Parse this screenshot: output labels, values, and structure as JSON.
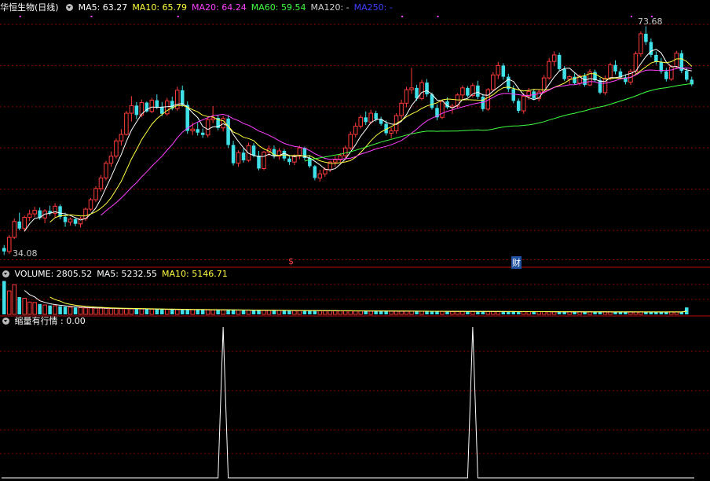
{
  "stock": {
    "name": "华恒生物",
    "period": "(日线)"
  },
  "ma_legend": [
    {
      "label": "MA5: 63.27",
      "color": "#ffffff"
    },
    {
      "label": "MA10: 65.79",
      "color": "#ffff40"
    },
    {
      "label": "MA20: 64.24",
      "color": "#ff40ff"
    },
    {
      "label": "MA60: 59.54",
      "color": "#40ff40"
    },
    {
      "label": "MA120: -",
      "color": "#d0d0d0"
    },
    {
      "label": "MA250: -",
      "color": "#4040ff"
    }
  ],
  "volume_legend": [
    {
      "label": "VOLUME: 2805.52",
      "color": "#ffffff"
    },
    {
      "label": "MA5: 5232.55",
      "color": "#ffffff"
    },
    {
      "label": "MA10: 5146.71",
      "color": "#ffff40"
    }
  ],
  "indicator_legend": {
    "label": "缩量有行情 : 0.00",
    "color": "#ffffff"
  },
  "price_high_label": "73.68",
  "price_low_label": "34.08",
  "event_badges": [
    {
      "text": "$",
      "color": "#ff4040",
      "bg": "#000000"
    },
    {
      "text": "财",
      "color": "#ffffff",
      "bg": "#2050a0"
    }
  ],
  "colors": {
    "up": "#ff3b3b",
    "down": "#40e0e8",
    "grid": "#8b0000",
    "ma5": "#ffffff",
    "ma10": "#ffff40",
    "ma20": "#ff40ff",
    "ma60": "#40ff40"
  },
  "chart_data": {
    "type": "candlestick",
    "price_range": [
      33,
      76
    ],
    "candles": [
      [
        36.0,
        36.5,
        34.8,
        35.4
      ],
      [
        35.4,
        38.2,
        35.0,
        37.8
      ],
      [
        37.8,
        41.0,
        37.5,
        40.5
      ],
      [
        40.5,
        42.0,
        39.0,
        39.3
      ],
      [
        39.3,
        41.5,
        38.8,
        41.2
      ],
      [
        41.2,
        42.5,
        40.6,
        41.8
      ],
      [
        41.8,
        43.0,
        41.3,
        42.4
      ],
      [
        42.4,
        42.9,
        40.8,
        41.1
      ],
      [
        41.1,
        42.6,
        40.2,
        42.3
      ],
      [
        42.3,
        43.2,
        41.5,
        41.9
      ],
      [
        41.9,
        43.6,
        41.2,
        43.1
      ],
      [
        43.1,
        43.4,
        40.9,
        41.3
      ],
      [
        41.3,
        42.0,
        39.6,
        40.4
      ],
      [
        40.4,
        41.2,
        39.8,
        40.9
      ],
      [
        40.9,
        41.1,
        39.7,
        40.1
      ],
      [
        40.1,
        41.3,
        39.5,
        41.0
      ],
      [
        41.0,
        42.9,
        40.6,
        42.6
      ],
      [
        42.6,
        44.5,
        42.3,
        44.2
      ],
      [
        44.2,
        46.5,
        43.8,
        46.1
      ],
      [
        46.1,
        48.4,
        45.6,
        47.9
      ],
      [
        47.9,
        50.8,
        47.5,
        50.4
      ],
      [
        50.4,
        52.4,
        49.8,
        51.6
      ],
      [
        51.6,
        54.6,
        51.2,
        54.2
      ],
      [
        54.2,
        56.2,
        53.4,
        55.3
      ],
      [
        55.3,
        59.3,
        55.1,
        58.9
      ],
      [
        58.9,
        61.8,
        57.5,
        60.2
      ],
      [
        60.2,
        60.8,
        57.9,
        58.6
      ],
      [
        58.6,
        61.2,
        58.2,
        60.7
      ],
      [
        60.7,
        60.9,
        59.0,
        59.2
      ],
      [
        59.2,
        61.5,
        58.9,
        61.1
      ],
      [
        61.1,
        62.1,
        59.6,
        59.9
      ],
      [
        59.9,
        60.8,
        58.4,
        58.8
      ],
      [
        58.8,
        61.5,
        58.5,
        61.0
      ],
      [
        61.0,
        61.7,
        59.4,
        59.7
      ],
      [
        59.7,
        63.4,
        59.3,
        62.8
      ],
      [
        62.8,
        63.6,
        60.0,
        60.3
      ],
      [
        60.3,
        60.9,
        55.4,
        55.9
      ],
      [
        55.9,
        57.3,
        55.2,
        56.2
      ],
      [
        56.2,
        57.3,
        55.1,
        55.6
      ],
      [
        55.6,
        56.3,
        54.7,
        55.2
      ],
      [
        55.2,
        58.2,
        54.8,
        57.8
      ],
      [
        57.8,
        60.1,
        57.2,
        58.1
      ],
      [
        58.1,
        58.6,
        56.0,
        56.4
      ],
      [
        56.4,
        58.4,
        55.8,
        58.0
      ],
      [
        58.0,
        58.6,
        53.0,
        53.5
      ],
      [
        53.5,
        54.2,
        50.0,
        50.4
      ],
      [
        50.4,
        52.6,
        49.8,
        52.2
      ],
      [
        52.2,
        53.0,
        50.5,
        50.9
      ],
      [
        50.9,
        53.9,
        50.6,
        53.4
      ],
      [
        53.4,
        53.8,
        51.4,
        51.7
      ],
      [
        51.7,
        52.5,
        49.2,
        49.5
      ],
      [
        49.5,
        52.5,
        49.2,
        52.3
      ],
      [
        52.3,
        53.4,
        51.6,
        52.8
      ],
      [
        52.8,
        53.4,
        51.2,
        51.6
      ],
      [
        51.6,
        52.9,
        51.0,
        52.5
      ],
      [
        52.5,
        52.8,
        50.8,
        51.2
      ],
      [
        51.2,
        51.7,
        50.1,
        50.6
      ],
      [
        50.6,
        51.9,
        50.1,
        51.6
      ],
      [
        51.6,
        53.4,
        51.1,
        53.0
      ],
      [
        53.0,
        53.2,
        50.9,
        51.3
      ],
      [
        51.3,
        51.8,
        49.6,
        49.9
      ],
      [
        49.9,
        50.1,
        47.5,
        47.9
      ],
      [
        47.9,
        49.3,
        47.3,
        48.6
      ],
      [
        48.6,
        49.7,
        48.1,
        49.3
      ],
      [
        49.3,
        50.8,
        48.9,
        50.6
      ],
      [
        50.6,
        51.6,
        49.8,
        51.0
      ],
      [
        51.0,
        52.1,
        50.6,
        51.7
      ],
      [
        51.7,
        53.4,
        51.3,
        53.0
      ],
      [
        53.0,
        55.8,
        52.7,
        55.3
      ],
      [
        55.3,
        57.3,
        54.8,
        56.7
      ],
      [
        56.7,
        58.6,
        56.3,
        58.2
      ],
      [
        58.2,
        59.2,
        56.9,
        57.4
      ],
      [
        57.4,
        59.5,
        57.0,
        58.9
      ],
      [
        58.9,
        59.3,
        57.5,
        57.9
      ],
      [
        57.9,
        58.3,
        56.8,
        57.1
      ],
      [
        57.1,
        57.7,
        55.1,
        55.5
      ],
      [
        55.5,
        56.4,
        54.6,
        55.9
      ],
      [
        55.9,
        58.9,
        55.4,
        58.5
      ],
      [
        58.5,
        61.2,
        57.9,
        60.6
      ],
      [
        60.6,
        63.4,
        59.9,
        62.9
      ],
      [
        62.9,
        66.6,
        62.2,
        63.2
      ],
      [
        63.2,
        63.7,
        61.0,
        61.4
      ],
      [
        61.4,
        64.6,
        61.1,
        64.1
      ],
      [
        64.1,
        64.7,
        61.7,
        62.1
      ],
      [
        62.1,
        62.4,
        59.5,
        59.8
      ],
      [
        59.8,
        60.4,
        57.7,
        58.2
      ],
      [
        58.2,
        61.2,
        57.9,
        60.9
      ],
      [
        60.9,
        61.6,
        59.6,
        59.9
      ],
      [
        59.9,
        60.5,
        58.8,
        60.1
      ],
      [
        60.1,
        62.3,
        59.8,
        62.0
      ],
      [
        62.0,
        63.6,
        61.3,
        63.2
      ],
      [
        63.2,
        63.5,
        61.6,
        61.9
      ],
      [
        61.9,
        64.0,
        61.6,
        63.6
      ],
      [
        63.6,
        64.4,
        61.3,
        61.7
      ],
      [
        61.7,
        62.2,
        59.2,
        59.6
      ],
      [
        59.6,
        63.2,
        59.3,
        62.9
      ],
      [
        62.9,
        65.9,
        62.6,
        65.4
      ],
      [
        65.4,
        67.6,
        64.7,
        67.0
      ],
      [
        67.0,
        67.4,
        64.6,
        65.1
      ],
      [
        65.1,
        65.6,
        62.5,
        63.0
      ],
      [
        63.0,
        63.6,
        60.6,
        61.0
      ],
      [
        61.0,
        61.4,
        58.9,
        59.3
      ],
      [
        59.3,
        62.3,
        58.8,
        61.8
      ],
      [
        61.8,
        63.2,
        61.2,
        62.6
      ],
      [
        62.6,
        63.0,
        61.1,
        61.4
      ],
      [
        61.4,
        62.9,
        60.9,
        62.5
      ],
      [
        62.5,
        65.4,
        62.2,
        64.9
      ],
      [
        64.9,
        68.3,
        64.6,
        67.7
      ],
      [
        67.7,
        69.4,
        66.9,
        68.8
      ],
      [
        68.8,
        69.2,
        66.1,
        66.4
      ],
      [
        66.4,
        66.9,
        64.4,
        64.7
      ],
      [
        64.7,
        65.4,
        63.8,
        65.1
      ],
      [
        65.1,
        65.7,
        63.8,
        64.0
      ],
      [
        64.0,
        65.5,
        63.6,
        65.2
      ],
      [
        65.2,
        65.7,
        63.4,
        63.7
      ],
      [
        63.7,
        66.4,
        63.5,
        65.9
      ],
      [
        65.9,
        66.3,
        64.2,
        64.5
      ],
      [
        64.5,
        64.9,
        62.1,
        62.4
      ],
      [
        62.4,
        65.3,
        62.0,
        64.8
      ],
      [
        64.8,
        67.5,
        64.5,
        67.1
      ],
      [
        67.1,
        67.9,
        65.5,
        66.0
      ],
      [
        66.0,
        66.5,
        64.7,
        65.0
      ],
      [
        65.0,
        65.5,
        63.8,
        64.2
      ],
      [
        64.2,
        66.4,
        63.7,
        66.0
      ],
      [
        66.0,
        69.4,
        65.6,
        69.0
      ],
      [
        69.0,
        72.8,
        68.5,
        72.4
      ],
      [
        72.4,
        73.68,
        70.5,
        71.0
      ],
      [
        71.0,
        71.6,
        68.4,
        68.8
      ],
      [
        68.8,
        69.4,
        67.2,
        67.6
      ],
      [
        67.6,
        68.3,
        65.6,
        66.0
      ],
      [
        66.0,
        66.6,
        64.3,
        64.7
      ],
      [
        64.7,
        67.1,
        64.4,
        66.8
      ],
      [
        66.8,
        69.5,
        66.4,
        69.1
      ],
      [
        69.1,
        69.6,
        65.7,
        66.1
      ],
      [
        66.1,
        66.6,
        64.3,
        64.6
      ],
      [
        64.6,
        65.1,
        63.5,
        63.8
      ]
    ],
    "volume_range": [
      0,
      14000
    ],
    "volume": [
      13500,
      9500,
      12000,
      7000,
      6500,
      5000,
      4800,
      4200,
      3800,
      3600,
      3500,
      3300,
      3100,
      2900,
      2800,
      2700,
      2600,
      2600,
      2500,
      2500,
      2400,
      2400,
      2350,
      2300,
      2300,
      2250,
      2200,
      2200,
      2150,
      2100,
      2100,
      2050,
      2000,
      2000,
      1950,
      1950,
      1900,
      1900,
      1900,
      1850,
      1850,
      1800,
      1800,
      1800,
      1750,
      1750,
      1700,
      1700,
      1700,
      1650,
      1650,
      1650,
      1600,
      1600,
      1600,
      1550,
      1550,
      1550,
      1500,
      1500,
      1500,
      1500,
      1450,
      1450,
      1450,
      1450,
      1400,
      1400,
      1400,
      1400,
      1400,
      1350,
      1350,
      1350,
      1350,
      1300,
      1300,
      1300,
      1300,
      1300,
      1300,
      1250,
      1250,
      1250,
      1250,
      1250,
      1200,
      1200,
      1200,
      1200,
      1200,
      1200,
      1200,
      1150,
      1150,
      1150,
      1150,
      1150,
      1150,
      1100,
      1100,
      1100,
      1100,
      1100,
      1100,
      1100,
      1100,
      1050,
      1050,
      1050,
      1050,
      1050,
      1050,
      1050,
      1050,
      1000,
      1000,
      1000,
      1000,
      1000,
      1000,
      1000,
      1000,
      1000,
      1000,
      1000,
      1000,
      1000,
      1000,
      1000,
      1000,
      1000,
      1000,
      1000,
      2805.52
    ],
    "indicator_range": [
      0,
      1
    ],
    "indicator_spikes": [
      43,
      92
    ]
  }
}
